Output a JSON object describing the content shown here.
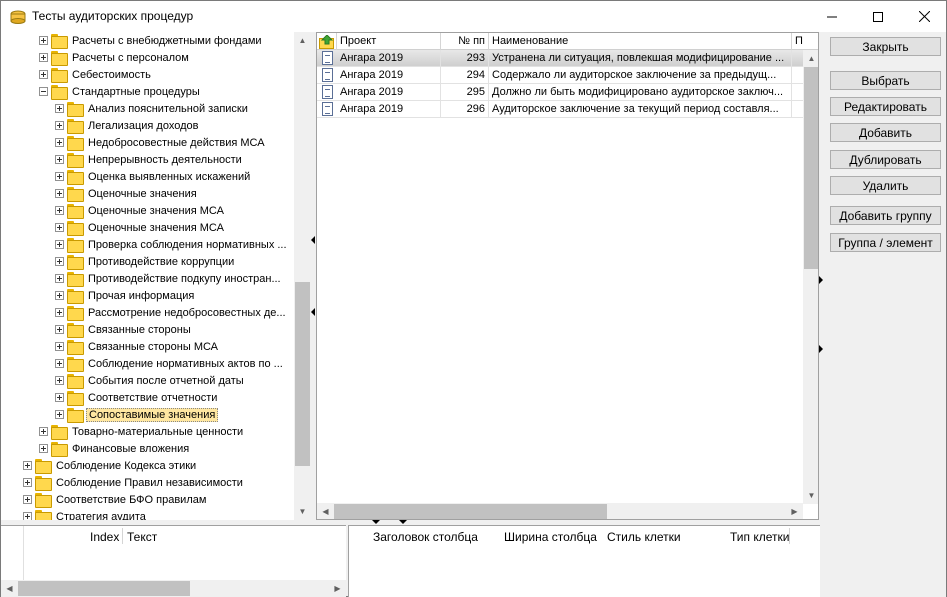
{
  "window": {
    "title": "Тесты аудиторских процедур"
  },
  "tree": {
    "items": [
      {
        "label": "Расчеты с внебюджетными фондами",
        "level": 2,
        "expander": "plus"
      },
      {
        "label": "Расчеты с персоналом",
        "level": 2,
        "expander": "plus"
      },
      {
        "label": "Себестоимость",
        "level": 2,
        "expander": "plus"
      },
      {
        "label": "Стандартные процедуры",
        "level": 2,
        "expander": "minus"
      },
      {
        "label": "Анализ пояснительной записки",
        "level": 3,
        "expander": "plus"
      },
      {
        "label": "Легализация доходов",
        "level": 3,
        "expander": "plus"
      },
      {
        "label": "Недобросовестные действия МСА",
        "level": 3,
        "expander": "plus"
      },
      {
        "label": "Непрерывность деятельности",
        "level": 3,
        "expander": "plus"
      },
      {
        "label": "Оценка выявленных искажений",
        "level": 3,
        "expander": "plus"
      },
      {
        "label": "Оценочные значения",
        "level": 3,
        "expander": "plus"
      },
      {
        "label": "Оценочные значения МСА",
        "level": 3,
        "expander": "plus"
      },
      {
        "label": "Оценочные значения МСА",
        "level": 3,
        "expander": "plus"
      },
      {
        "label": "Проверка соблюдения нормативных ...",
        "level": 3,
        "expander": "plus"
      },
      {
        "label": "Противодействие коррупции",
        "level": 3,
        "expander": "plus"
      },
      {
        "label": "Противодействие подкупу иностран...",
        "level": 3,
        "expander": "plus"
      },
      {
        "label": "Прочая информация",
        "level": 3,
        "expander": "plus"
      },
      {
        "label": "Рассмотрение недобросовестных де...",
        "level": 3,
        "expander": "plus"
      },
      {
        "label": "Связанные стороны",
        "level": 3,
        "expander": "plus"
      },
      {
        "label": "Связанные стороны МСА",
        "level": 3,
        "expander": "plus"
      },
      {
        "label": "Соблюдение нормативных актов по ...",
        "level": 3,
        "expander": "plus"
      },
      {
        "label": "События после отчетной даты",
        "level": 3,
        "expander": "plus"
      },
      {
        "label": "Соответствие отчетности",
        "level": 3,
        "expander": "plus"
      },
      {
        "label": "Сопоставимые значения",
        "level": 3,
        "expander": "plus",
        "selected": true
      },
      {
        "label": "Товарно-материальные ценности",
        "level": 2,
        "expander": "plus"
      },
      {
        "label": "Финансовые вложения",
        "level": 2,
        "expander": "plus"
      },
      {
        "label": "Соблюдение Кодекса этики",
        "level": 1,
        "expander": "plus"
      },
      {
        "label": "Соблюдение Правил независимости",
        "level": 1,
        "expander": "plus"
      },
      {
        "label": "Соответствие БФО правилам",
        "level": 1,
        "expander": "plus"
      },
      {
        "label": "Стратегия аудита",
        "level": 1,
        "expander": "plus"
      }
    ]
  },
  "grid": {
    "columns": [
      "Проект",
      "№ пп",
      "Наименование",
      "П"
    ],
    "rows": [
      {
        "project": "Ангара 2019",
        "num": "293",
        "name": "Устранена ли ситуация, повлекшая модифицирование ...",
        "active": true
      },
      {
        "project": "Ангара 2019",
        "num": "294",
        "name": "Содержало ли аудиторское заключение за предыдущ..."
      },
      {
        "project": "Ангара 2019",
        "num": "295",
        "name": "Должно ли быть модифицировано аудиторское заключ..."
      },
      {
        "project": "Ангара 2019",
        "num": "296",
        "name": "Аудиторское заключение за текущий период составля..."
      }
    ]
  },
  "buttons": {
    "close": "Закрыть",
    "select": "Выбрать",
    "edit": "Редактировать",
    "add": "Добавить",
    "duplicate": "Дублировать",
    "delete": "Удалить",
    "add_group": "Добавить группу",
    "group_element": "Группа / элемент"
  },
  "bottom_left": {
    "columns": [
      "Index",
      "Текст"
    ]
  },
  "bottom_right": {
    "columns": [
      "Заголовок столбца",
      "Ширина столбца",
      "Стиль клетки",
      "Тип клетки"
    ]
  }
}
